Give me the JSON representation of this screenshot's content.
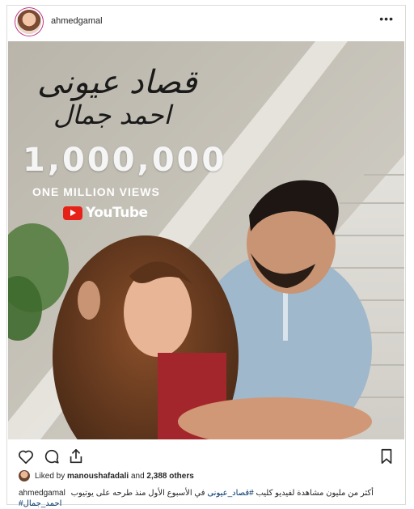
{
  "post": {
    "username": "ahmedgamal",
    "more_label": "•••"
  },
  "image": {
    "song_title_ar": "قصاد عيونى",
    "artist_ar": "احمد جمال",
    "views_number": "1,000,000",
    "views_label": "ONE MILLION VIEWS",
    "platform": "YouTube"
  },
  "actions": {
    "like_icon": "heart-icon",
    "comment_icon": "comment-icon",
    "share_icon": "share-icon",
    "save_icon": "bookmark-icon"
  },
  "likes": {
    "prefix": "Liked by",
    "liker": "manoushafadali",
    "middle": "and",
    "others": "2,388 others"
  },
  "caption": {
    "username": "ahmedgamal",
    "text": "أكثر من مليون مشاهدة لفيديو كليب",
    "hashtag1": "#قصاد_عيونى",
    "text2": "في الأسبوع الأول منذ طرحه على يوتيوب",
    "hashtag2": "#احمد_جمال"
  },
  "colors": {
    "youtube_red": "#e62117",
    "hashtag": "#003569",
    "border": "#dbdbdb"
  }
}
